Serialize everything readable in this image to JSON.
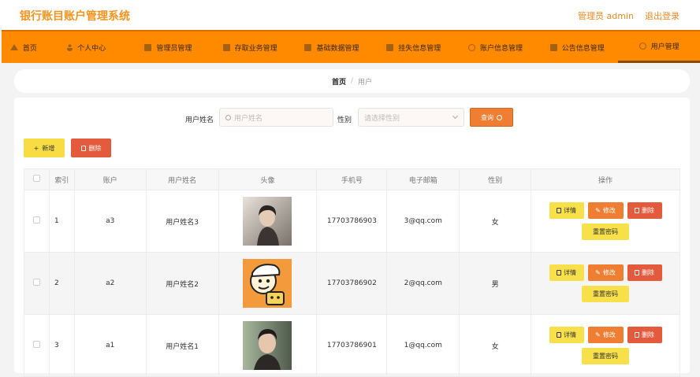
{
  "app": {
    "title": "银行账目账户管理系统"
  },
  "topbar": {
    "user_label": "管理员 admin",
    "logout_label": "退出登录"
  },
  "nav": {
    "items": [
      {
        "label": "首页",
        "icon": "home-icon"
      },
      {
        "label": "个人中心",
        "icon": "person-icon"
      },
      {
        "label": "管理员管理",
        "icon": "grid-icon"
      },
      {
        "label": "存取业务管理",
        "icon": "folder-icon"
      },
      {
        "label": "基础数据管理",
        "icon": "grid-icon"
      },
      {
        "label": "挂失信息管理",
        "icon": "doc-icon"
      },
      {
        "label": "账户信息管理",
        "icon": "circle-icon"
      },
      {
        "label": "公告信息管理",
        "icon": "grid-icon"
      },
      {
        "label": "用户管理",
        "icon": "circle-icon"
      }
    ],
    "active_index": 8
  },
  "breadcrumb": {
    "home": "首页",
    "separator": "/",
    "current": "用户"
  },
  "search": {
    "name_label": "用户姓名",
    "name_placeholder": "用户姓名",
    "gender_label": "性别",
    "gender_placeholder": "请选择性别",
    "query_label": "查询"
  },
  "actions": {
    "add_label": "新增",
    "delete_label": "删除"
  },
  "table": {
    "headers": [
      "索引",
      "账户",
      "用户姓名",
      "头像",
      "手机号",
      "电子邮箱",
      "性别",
      "操作"
    ],
    "rows": [
      {
        "index": "1",
        "account": "a3",
        "name": "用户姓名3",
        "phone": "17703786903",
        "email": "3@qq.com",
        "gender": "女"
      },
      {
        "index": "2",
        "account": "a2",
        "name": "用户姓名2",
        "phone": "17703786902",
        "email": "2@qq.com",
        "gender": "男"
      },
      {
        "index": "3",
        "account": "a1",
        "name": "用户姓名1",
        "phone": "17703786901",
        "email": "1@qq.com",
        "gender": "女"
      }
    ],
    "row_actions": {
      "detail": "详情",
      "edit": "修改",
      "delete": "删除",
      "reset": "重置密码"
    }
  },
  "colors": {
    "accent": "#ff8a00",
    "title": "#f7931e",
    "query": "#f07e32",
    "add": "#f7dc43",
    "danger": "#e35a3c"
  }
}
